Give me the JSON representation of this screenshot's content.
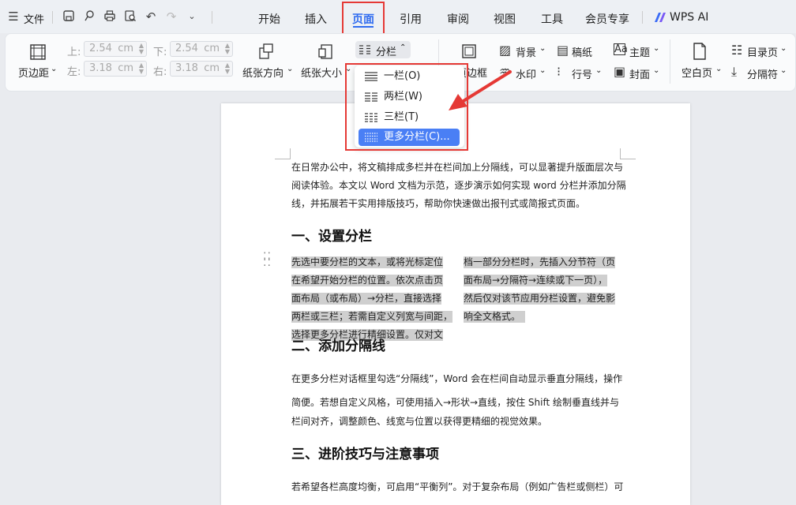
{
  "topbar": {
    "file_label": "文件",
    "tabs": [
      {
        "label": "开始"
      },
      {
        "label": "插入"
      },
      {
        "label": "页面"
      },
      {
        "label": "引用"
      },
      {
        "label": "审阅"
      },
      {
        "label": "视图"
      },
      {
        "label": "工具"
      },
      {
        "label": "会员专享"
      },
      {
        "label": "WPS AI"
      }
    ]
  },
  "ribbon": {
    "margin_btn": "页边距",
    "top_label": "上:",
    "top_value": "2.54",
    "bottom_label": "下:",
    "bottom_value": "2.54",
    "left_label": "左:",
    "left_value": "3.18",
    "right_label": "右:",
    "right_value": "3.18",
    "unit": "cm",
    "orientation_btn": "纸张方向",
    "size_btn": "纸张大小",
    "columns_btn": "分栏",
    "border_btn": "页边框",
    "background_btn": "背景",
    "watermark_btn": "水印",
    "paper_btn": "稿纸",
    "line_no_btn": "行号",
    "theme_btn": "主题",
    "cover_btn": "封面",
    "blank_btn": "空白页",
    "toc_btn": "目录页",
    "separator_btn": "分隔符"
  },
  "columns_menu": {
    "items": [
      {
        "label": "一栏(O)"
      },
      {
        "label": "两栏(W)"
      },
      {
        "label": "三栏(T)"
      },
      {
        "label": "更多分栏(C)..."
      }
    ]
  },
  "document": {
    "intro": [
      "在日常办公中，将文稿排成多栏并在栏间加上分隔线，可以显著提升版面层次与",
      "阅读体验。本文以 Word 文档为示范，逐步演示如何实现 word 分栏并添加分隔",
      "线，并拓展若干实用排版技巧，帮助你快速做出报刊式或简报式页面。"
    ],
    "h1": "一、设置分栏",
    "col1": [
      "先选中要分栏的文本，或将光标定位",
      "在希望开始分栏的位置。依次点击页",
      "面布局（或布局）→分栏，直接选择",
      "两栏或三栏；若需自定义列宽与间距，",
      "选择更多分栏进行精细设置。仅对文"
    ],
    "col2": [
      "档一部分分栏时，先插入分节符（页",
      "面布局→分隔符→连续或下一页），",
      "然后仅对该节应用分栏设置，避免影",
      "响全文格式。"
    ],
    "h2": "二、添加分隔线",
    "p2": [
      "在更多分栏对话框里勾选“分隔线”，Word 会在栏间自动显示垂直分隔线，操作",
      "简便。若想自定义风格，可使用插入→形状→直线，按住 Shift 绘制垂直线并与",
      "栏间对齐，调整颜色、线宽与位置以获得更精细的视觉效果。"
    ],
    "h3": "三、进阶技巧与注意事项",
    "p3": [
      "若希望各栏高度均衡，可启用“平衡列”。对于复杂布局（例如广告栏或侧栏）可"
    ]
  },
  "colors": {
    "accent": "#4a7ff5",
    "highlight": "#e53935",
    "selection": "#cfcfcf"
  }
}
